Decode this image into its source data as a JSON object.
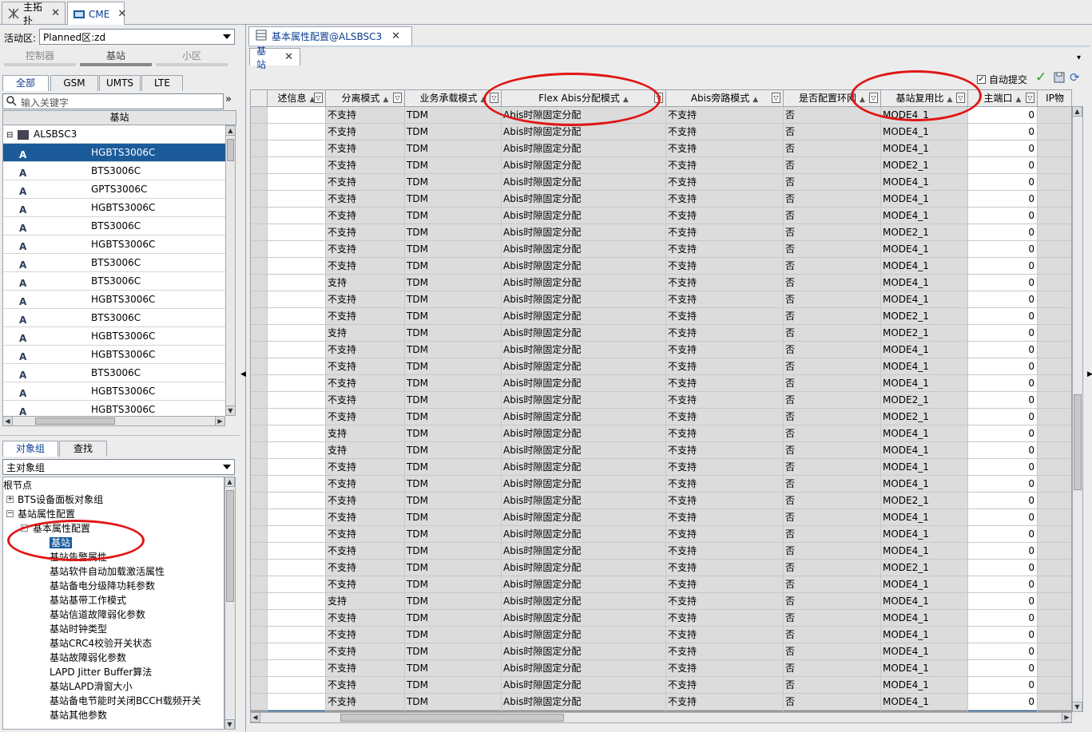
{
  "top_tabs": [
    {
      "label": "主拓扑",
      "icon": "topology-icon"
    },
    {
      "label": "CME",
      "icon": "cme-icon"
    }
  ],
  "left": {
    "active_area_label": "活动区:",
    "active_area_value": "Planned区:zd",
    "segments": [
      "控制器",
      "基站",
      "小区"
    ],
    "net_tabs": [
      "全部",
      "GSM",
      "UMTS",
      "LTE"
    ],
    "search_placeholder": "输入关键字",
    "list_header": "基站",
    "list_root": "ALSBSC3",
    "list_items": [
      "HGBTS3006C",
      "BTS3006C",
      "GPTS3006C",
      "HGBTS3006C",
      "BTS3006C",
      "HGBTS3006C",
      "BTS3006C",
      "BTS3006C",
      "HGBTS3006C",
      "BTS3006C",
      "HGBTS3006C",
      "HGBTS3006C",
      "BTS3006C",
      "HGBTS3006C",
      "HGBTS3006C"
    ],
    "obj_tabs": [
      "对象组",
      "查找"
    ],
    "obj_group_value": "主对象组",
    "tree": {
      "root": "根节点",
      "n1": "BTS设备面板对象组",
      "n2": "基站属性配置",
      "n3": "基本属性配置",
      "children": [
        "基站",
        "基站告警属性",
        "基站软件自动加载激活属性",
        "基站备电分级降功耗参数",
        "基站基带工作模式",
        "基站信道故障弱化参数",
        "基站时钟类型",
        "基站CRC4校验开关状态",
        "基站故障弱化参数",
        "LAPD Jitter Buffer算法",
        "基站LAPD滑窗大小",
        "基站备电节能时关闭BCCH载频开关",
        "基站其他参数"
      ]
    }
  },
  "right": {
    "main_tab": "基本属性配置@ALSBSC3",
    "sub_tab": "基站",
    "auto_submit_label": "自动提交",
    "auto_submit_checked": true,
    "columns": [
      "述信息",
      "分离模式",
      "业务承载模式",
      "Flex Abis分配模式",
      "Abis旁路模式",
      "是否配置环网",
      "基站复用比",
      "主端口",
      "IP物"
    ],
    "rows": [
      [
        "",
        "不支持",
        "TDM",
        "Abis时隙固定分配",
        "不支持",
        "否",
        "MODE4_1",
        "0"
      ],
      [
        "",
        "不支持",
        "TDM",
        "Abis时隙固定分配",
        "不支持",
        "否",
        "MODE4_1",
        "0"
      ],
      [
        "",
        "不支持",
        "TDM",
        "Abis时隙固定分配",
        "不支持",
        "否",
        "MODE4_1",
        "0"
      ],
      [
        "",
        "不支持",
        "TDM",
        "Abis时隙固定分配",
        "不支持",
        "否",
        "MODE2_1",
        "0"
      ],
      [
        "",
        "不支持",
        "TDM",
        "Abis时隙固定分配",
        "不支持",
        "否",
        "MODE4_1",
        "0"
      ],
      [
        "",
        "不支持",
        "TDM",
        "Abis时隙固定分配",
        "不支持",
        "否",
        "MODE4_1",
        "0"
      ],
      [
        "",
        "不支持",
        "TDM",
        "Abis时隙固定分配",
        "不支持",
        "否",
        "MODE4_1",
        "0"
      ],
      [
        "",
        "不支持",
        "TDM",
        "Abis时隙固定分配",
        "不支持",
        "否",
        "MODE2_1",
        "0"
      ],
      [
        "",
        "不支持",
        "TDM",
        "Abis时隙固定分配",
        "不支持",
        "否",
        "MODE4_1",
        "0"
      ],
      [
        "",
        "不支持",
        "TDM",
        "Abis时隙固定分配",
        "不支持",
        "否",
        "MODE4_1",
        "0"
      ],
      [
        "",
        "支持",
        "TDM",
        "Abis时隙固定分配",
        "不支持",
        "否",
        "MODE4_1",
        "0"
      ],
      [
        "",
        "不支持",
        "TDM",
        "Abis时隙固定分配",
        "不支持",
        "否",
        "MODE4_1",
        "0"
      ],
      [
        "",
        "不支持",
        "TDM",
        "Abis时隙固定分配",
        "不支持",
        "否",
        "MODE2_1",
        "0"
      ],
      [
        "",
        "支持",
        "TDM",
        "Abis时隙固定分配",
        "不支持",
        "否",
        "MODE2_1",
        "0"
      ],
      [
        "",
        "不支持",
        "TDM",
        "Abis时隙固定分配",
        "不支持",
        "否",
        "MODE4_1",
        "0"
      ],
      [
        "",
        "不支持",
        "TDM",
        "Abis时隙固定分配",
        "不支持",
        "否",
        "MODE4_1",
        "0"
      ],
      [
        "",
        "不支持",
        "TDM",
        "Abis时隙固定分配",
        "不支持",
        "否",
        "MODE4_1",
        "0"
      ],
      [
        "",
        "不支持",
        "TDM",
        "Abis时隙固定分配",
        "不支持",
        "否",
        "MODE2_1",
        "0"
      ],
      [
        "",
        "不支持",
        "TDM",
        "Abis时隙固定分配",
        "不支持",
        "否",
        "MODE2_1",
        "0"
      ],
      [
        "",
        "支持",
        "TDM",
        "Abis时隙固定分配",
        "不支持",
        "否",
        "MODE4_1",
        "0"
      ],
      [
        "",
        "支持",
        "TDM",
        "Abis时隙固定分配",
        "不支持",
        "否",
        "MODE4_1",
        "0"
      ],
      [
        "",
        "不支持",
        "TDM",
        "Abis时隙固定分配",
        "不支持",
        "否",
        "MODE4_1",
        "0"
      ],
      [
        "",
        "不支持",
        "TDM",
        "Abis时隙固定分配",
        "不支持",
        "否",
        "MODE4_1",
        "0"
      ],
      [
        "",
        "不支持",
        "TDM",
        "Abis时隙固定分配",
        "不支持",
        "否",
        "MODE2_1",
        "0"
      ],
      [
        "",
        "不支持",
        "TDM",
        "Abis时隙固定分配",
        "不支持",
        "否",
        "MODE4_1",
        "0"
      ],
      [
        "",
        "不支持",
        "TDM",
        "Abis时隙固定分配",
        "不支持",
        "否",
        "MODE4_1",
        "0"
      ],
      [
        "",
        "不支持",
        "TDM",
        "Abis时隙固定分配",
        "不支持",
        "否",
        "MODE4_1",
        "0"
      ],
      [
        "",
        "不支持",
        "TDM",
        "Abis时隙固定分配",
        "不支持",
        "否",
        "MODE2_1",
        "0"
      ],
      [
        "",
        "不支持",
        "TDM",
        "Abis时隙固定分配",
        "不支持",
        "否",
        "MODE4_1",
        "0"
      ],
      [
        "",
        "支持",
        "TDM",
        "Abis时隙固定分配",
        "不支持",
        "否",
        "MODE4_1",
        "0"
      ],
      [
        "",
        "不支持",
        "TDM",
        "Abis时隙固定分配",
        "不支持",
        "否",
        "MODE4_1",
        "0"
      ],
      [
        "",
        "不支持",
        "TDM",
        "Abis时隙固定分配",
        "不支持",
        "否",
        "MODE4_1",
        "0"
      ],
      [
        "",
        "不支持",
        "TDM",
        "Abis时隙固定分配",
        "不支持",
        "否",
        "MODE4_1",
        "0"
      ],
      [
        "",
        "不支持",
        "TDM",
        "Abis时隙固定分配",
        "不支持",
        "否",
        "MODE4_1",
        "0"
      ],
      [
        "",
        "不支持",
        "TDM",
        "Abis时隙固定分配",
        "不支持",
        "否",
        "MODE4_1",
        "0"
      ],
      [
        "",
        "不支持",
        "TDM",
        "Abis时隙固定分配",
        "不支持",
        "否",
        "MODE4_1",
        "0"
      ],
      [
        "",
        "不支持",
        "TDM",
        "Abis时隙固定分配",
        "不支持",
        "否",
        "MODE4_1",
        "0"
      ]
    ],
    "selected_row_index": 36
  },
  "colors": {
    "selection": "#1b5b9a",
    "annotation": "#e01616",
    "link_blue": "#0a3d91",
    "check_green": "#2a9d2a"
  }
}
